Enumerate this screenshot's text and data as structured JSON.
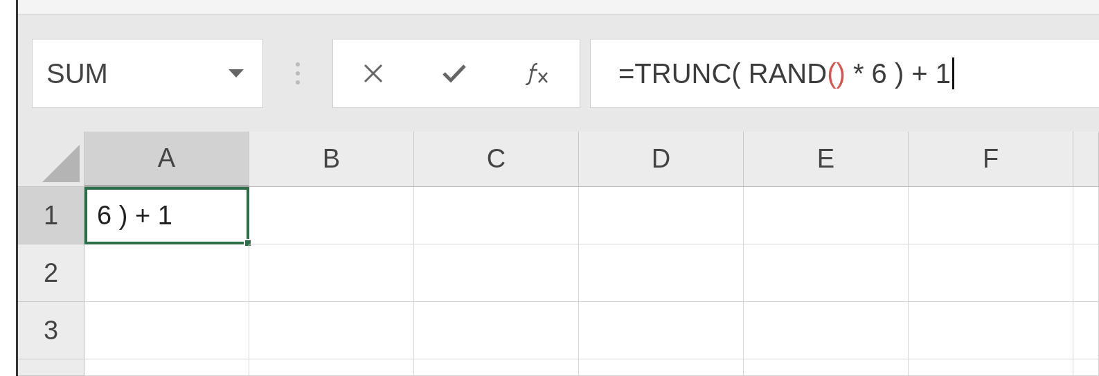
{
  "name_box": {
    "value": "SUM"
  },
  "formula_buttons": [
    {
      "kind": "cancel"
    },
    {
      "kind": "enter"
    },
    {
      "kind": "function"
    }
  ],
  "formula_parts": [
    {
      "text": "=TRUNC( RAND",
      "color": "#3c3c3c"
    },
    {
      "text": "()",
      "color": "#d9534f"
    },
    {
      "text": " * 6 ) + 1",
      "color": "#3c3c3c"
    }
  ],
  "columns": [
    {
      "label": "A",
      "selected": true
    },
    {
      "label": "B",
      "selected": false
    },
    {
      "label": "C",
      "selected": false
    },
    {
      "label": "D",
      "selected": false
    },
    {
      "label": "E",
      "selected": false
    },
    {
      "label": "F",
      "selected": false
    }
  ],
  "rows": [
    {
      "label": "1",
      "selected": true,
      "cells": [
        {
          "text": "6 ) + 1",
          "selected": true
        }
      ]
    },
    {
      "label": "2",
      "selected": false
    },
    {
      "label": "3",
      "selected": false
    }
  ]
}
